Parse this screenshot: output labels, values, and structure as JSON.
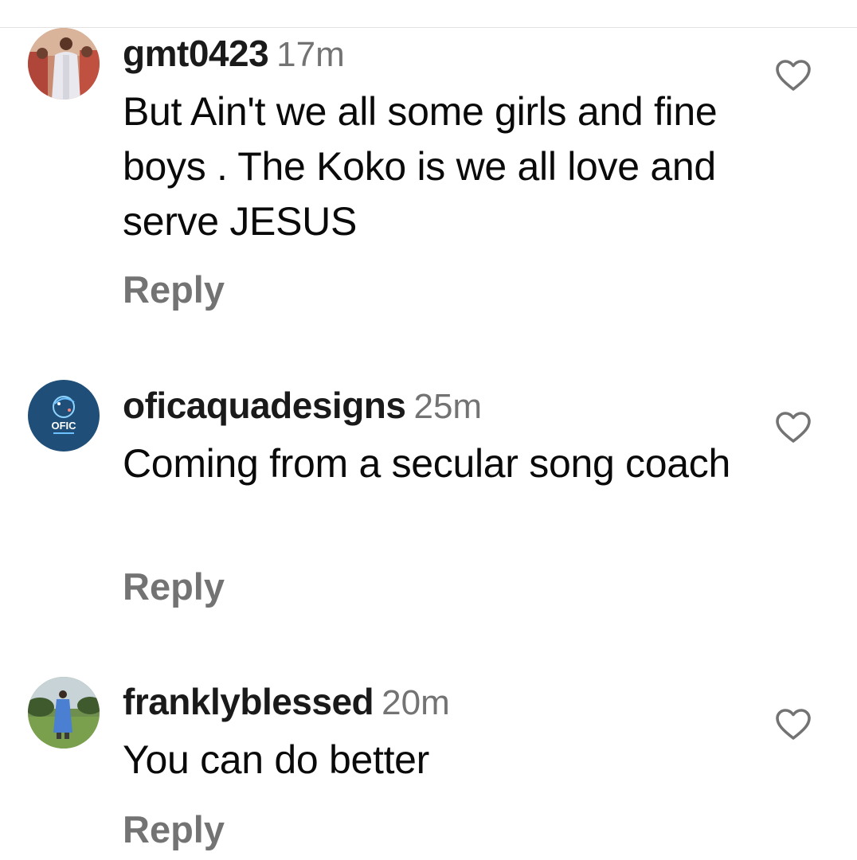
{
  "comments": [
    {
      "username": "gmt0423",
      "time": "17m",
      "text": "But Ain't we all some girls and fine boys . The Koko is we all love and serve JESUS",
      "reply_label": "Reply",
      "avatar_icon": "photo-avatar",
      "like_icon": "heart-outline-icon"
    },
    {
      "username": "oficaquadesigns",
      "time": "25m",
      "text": "Coming from a secular song coach",
      "reply_label": "Reply",
      "avatar_icon": "logo-avatar",
      "avatar_logo_text": "OFIC",
      "like_icon": "heart-outline-icon"
    },
    {
      "username": "franklyblessed",
      "time": "20m",
      "text": "You can do better",
      "reply_label": "Reply",
      "avatar_icon": "photo-avatar",
      "like_icon": "heart-outline-icon"
    }
  ],
  "colors": {
    "username": "#1a1a1a",
    "meta": "#737373",
    "text": "#0a0a0a",
    "logo_avatar_bg": "#1f4f78"
  }
}
